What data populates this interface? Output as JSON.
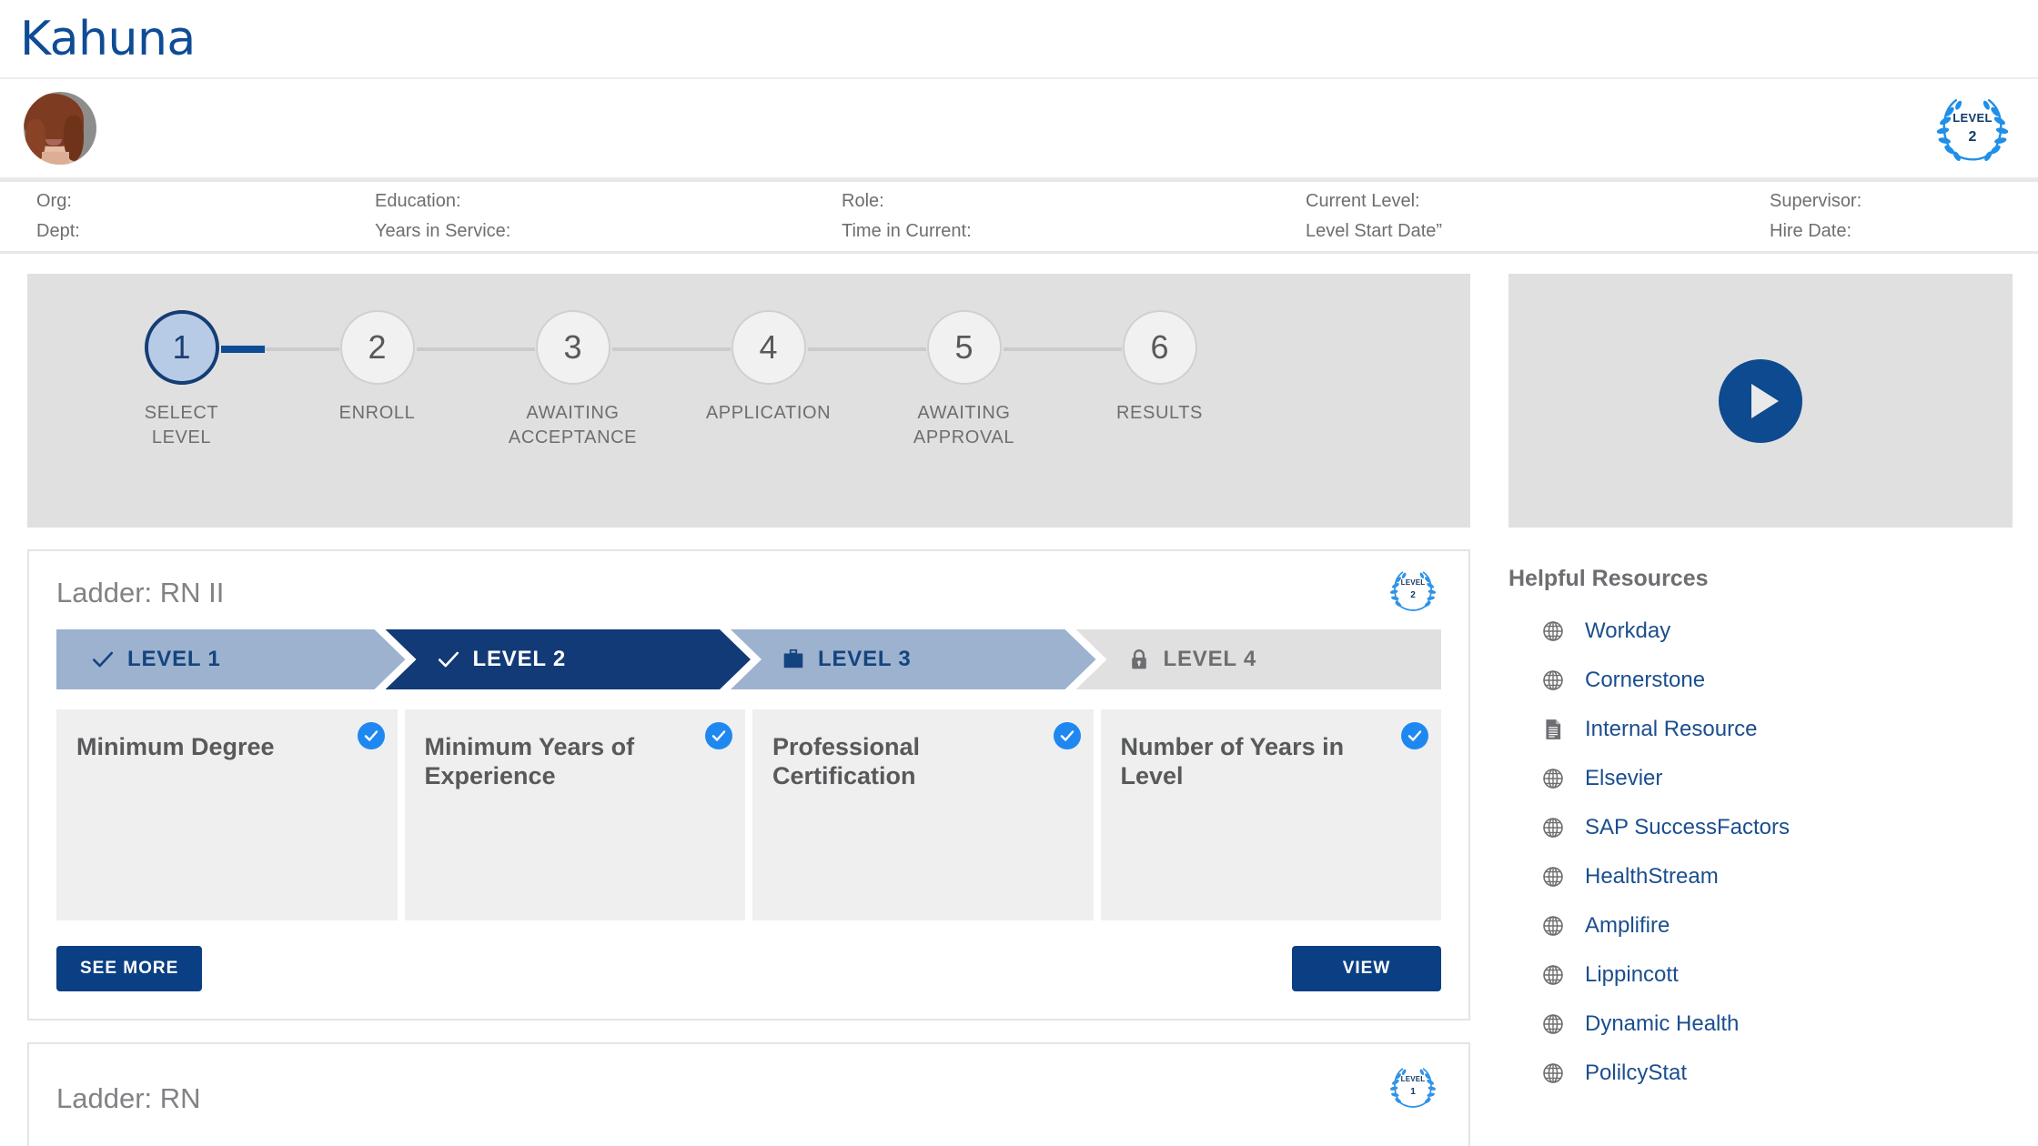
{
  "brand": {
    "name": "Kahuna"
  },
  "profile": {
    "avatar_alt": "user-avatar",
    "level_badge": {
      "word": "LEVEL",
      "number": "2"
    }
  },
  "meta": {
    "columns": [
      {
        "line1": "Org:",
        "line2": "Dept:"
      },
      {
        "line1": "Education:",
        "line2": "Years in Service:"
      },
      {
        "line1": "Role:",
        "line2": "Time in Current:"
      },
      {
        "line1": "Current Level:",
        "line2": "Level Start Date”"
      },
      {
        "line1": "Supervisor:",
        "line2": "Hire Date:"
      }
    ]
  },
  "stepper": {
    "active_index": 0,
    "steps": [
      {
        "number": "1",
        "label": "SELECT\nLEVEL"
      },
      {
        "number": "2",
        "label": "ENROLL"
      },
      {
        "number": "3",
        "label": "AWAITING\nACCEPTANCE"
      },
      {
        "number": "4",
        "label": "APPLICATION"
      },
      {
        "number": "5",
        "label": "AWAITING\nAPPROVAL"
      },
      {
        "number": "6",
        "label": "RESULTS"
      }
    ]
  },
  "video": {
    "play_label": "play-video"
  },
  "ladder1": {
    "title": "Ladder: RN II",
    "badge": {
      "word": "LEVEL",
      "number": "2"
    },
    "levels": [
      {
        "label": "LEVEL 1",
        "icon": "check-icon",
        "state": "completed"
      },
      {
        "label": "LEVEL 2",
        "icon": "check-icon",
        "state": "current"
      },
      {
        "label": "LEVEL 3",
        "icon": "briefcase-icon",
        "state": "available"
      },
      {
        "label": "LEVEL 4",
        "icon": "lock-icon",
        "state": "locked"
      }
    ],
    "requirements": [
      {
        "title": "Minimum Degree",
        "checked": true
      },
      {
        "title": "Minimum Years of Experience",
        "checked": true
      },
      {
        "title": "Professional Certification",
        "checked": true
      },
      {
        "title": "Number of Years in Level",
        "checked": true
      }
    ],
    "see_more_label": "SEE MORE",
    "view_label": "VIEW"
  },
  "ladder2": {
    "title": "Ladder: RN",
    "badge": {
      "word": "LEVEL",
      "number": "1"
    }
  },
  "resources": {
    "title": "Helpful Resources",
    "items": [
      {
        "label": "Workday",
        "icon": "globe-icon"
      },
      {
        "label": "Cornerstone",
        "icon": "globe-icon"
      },
      {
        "label": "Internal Resource",
        "icon": "document-icon"
      },
      {
        "label": "Elsevier",
        "icon": "globe-icon"
      },
      {
        "label": "SAP SuccessFactors",
        "icon": "globe-icon"
      },
      {
        "label": "HealthStream",
        "icon": "globe-icon"
      },
      {
        "label": "Amplifire",
        "icon": "globe-icon"
      },
      {
        "label": "Lippincott",
        "icon": "globe-icon"
      },
      {
        "label": "Dynamic Health",
        "icon": "globe-icon"
      },
      {
        "label": "PolilcyStat",
        "icon": "globe-icon"
      }
    ]
  },
  "colors": {
    "brand_blue": "#0f4c96",
    "navy": "#123a76",
    "muted_blue": "#9cb2ce",
    "panel_gray": "#e0e0e0",
    "card_gray": "#efefef",
    "check_blue": "#1e88f0",
    "text_gray": "#6d6e71"
  }
}
